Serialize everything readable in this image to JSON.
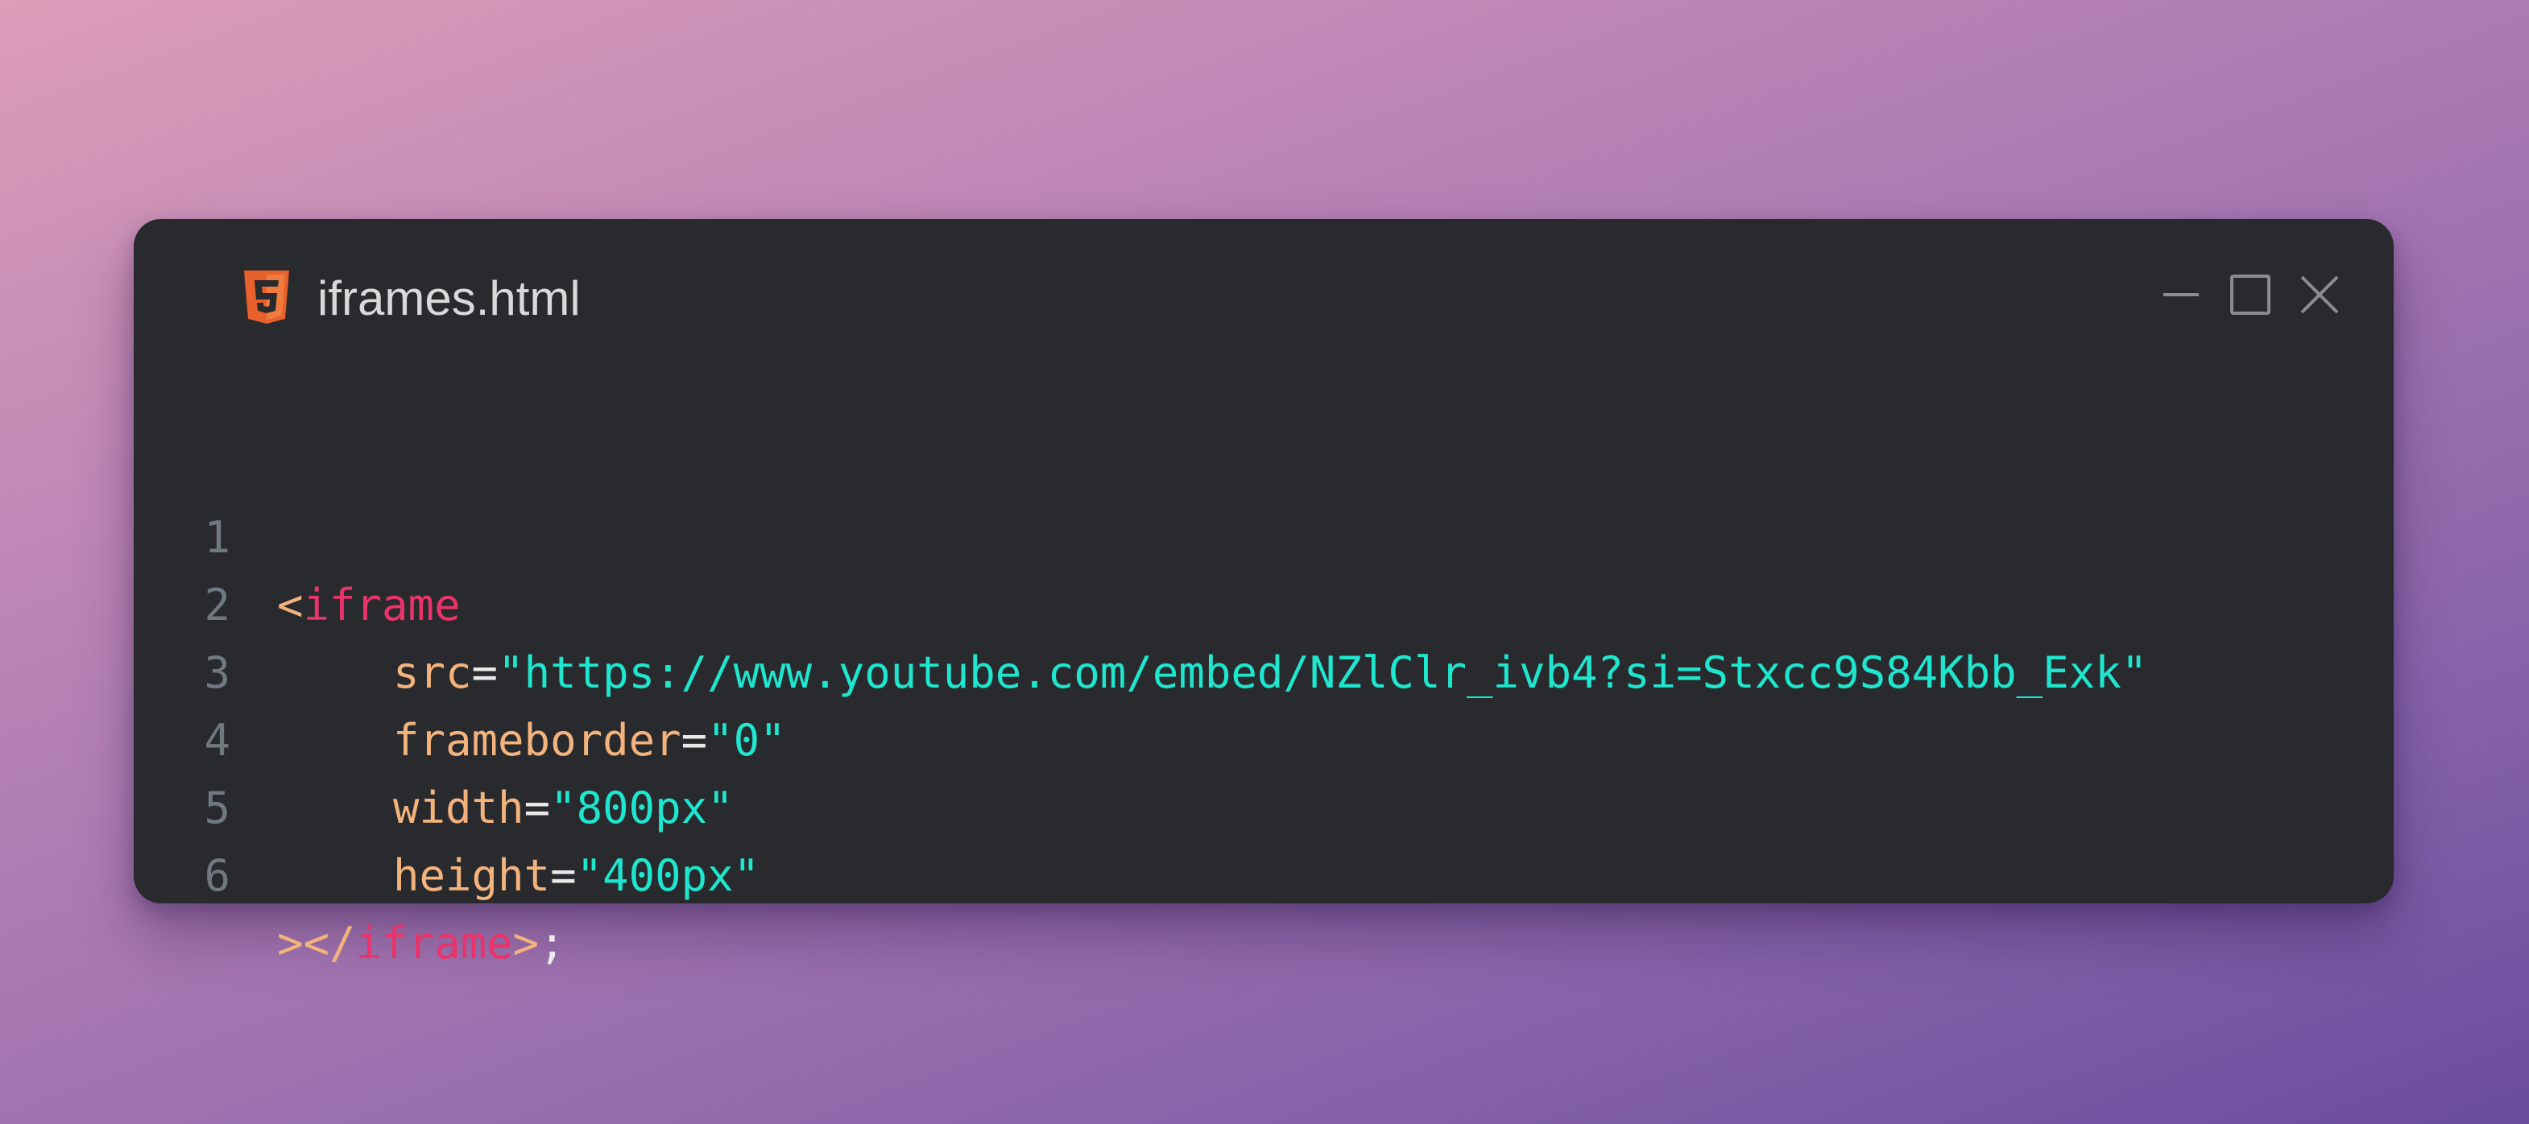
{
  "window": {
    "filename": "iframes.html",
    "file_icon": "html5-icon",
    "controls": {
      "minimize": "minimize-icon",
      "maximize": "maximize-icon",
      "close": "close-icon"
    }
  },
  "code": {
    "lines": [
      {
        "number": "1",
        "open_bracket": "<",
        "tag": "iframe"
      },
      {
        "number": "2",
        "attr": "src",
        "eq": "=",
        "value": "\"https://www.youtube.com/embed/NZlClr_ivb4?si=Stxcc9S84Kbb_Exk\""
      },
      {
        "number": "3",
        "attr": "frameborder",
        "eq": "=",
        "value": "\"0\""
      },
      {
        "number": "4",
        "attr": "width",
        "eq": "=",
        "value": "\"800px\""
      },
      {
        "number": "5",
        "attr": "height",
        "eq": "=",
        "value": "\"400px\""
      },
      {
        "number": "6",
        "close_open": "></",
        "tag": "iframe",
        "close_bracket": ">",
        "semicolon": ";"
      }
    ]
  },
  "colors": {
    "background_start": "#dc9db8",
    "background_end": "#6a4c9e",
    "window": "#292a2d",
    "tag": "#e9336a",
    "attribute": "#f3b37d",
    "string": "#1ee6cf",
    "line_number": "#6f7a80",
    "html5_icon": "#e8602b"
  }
}
